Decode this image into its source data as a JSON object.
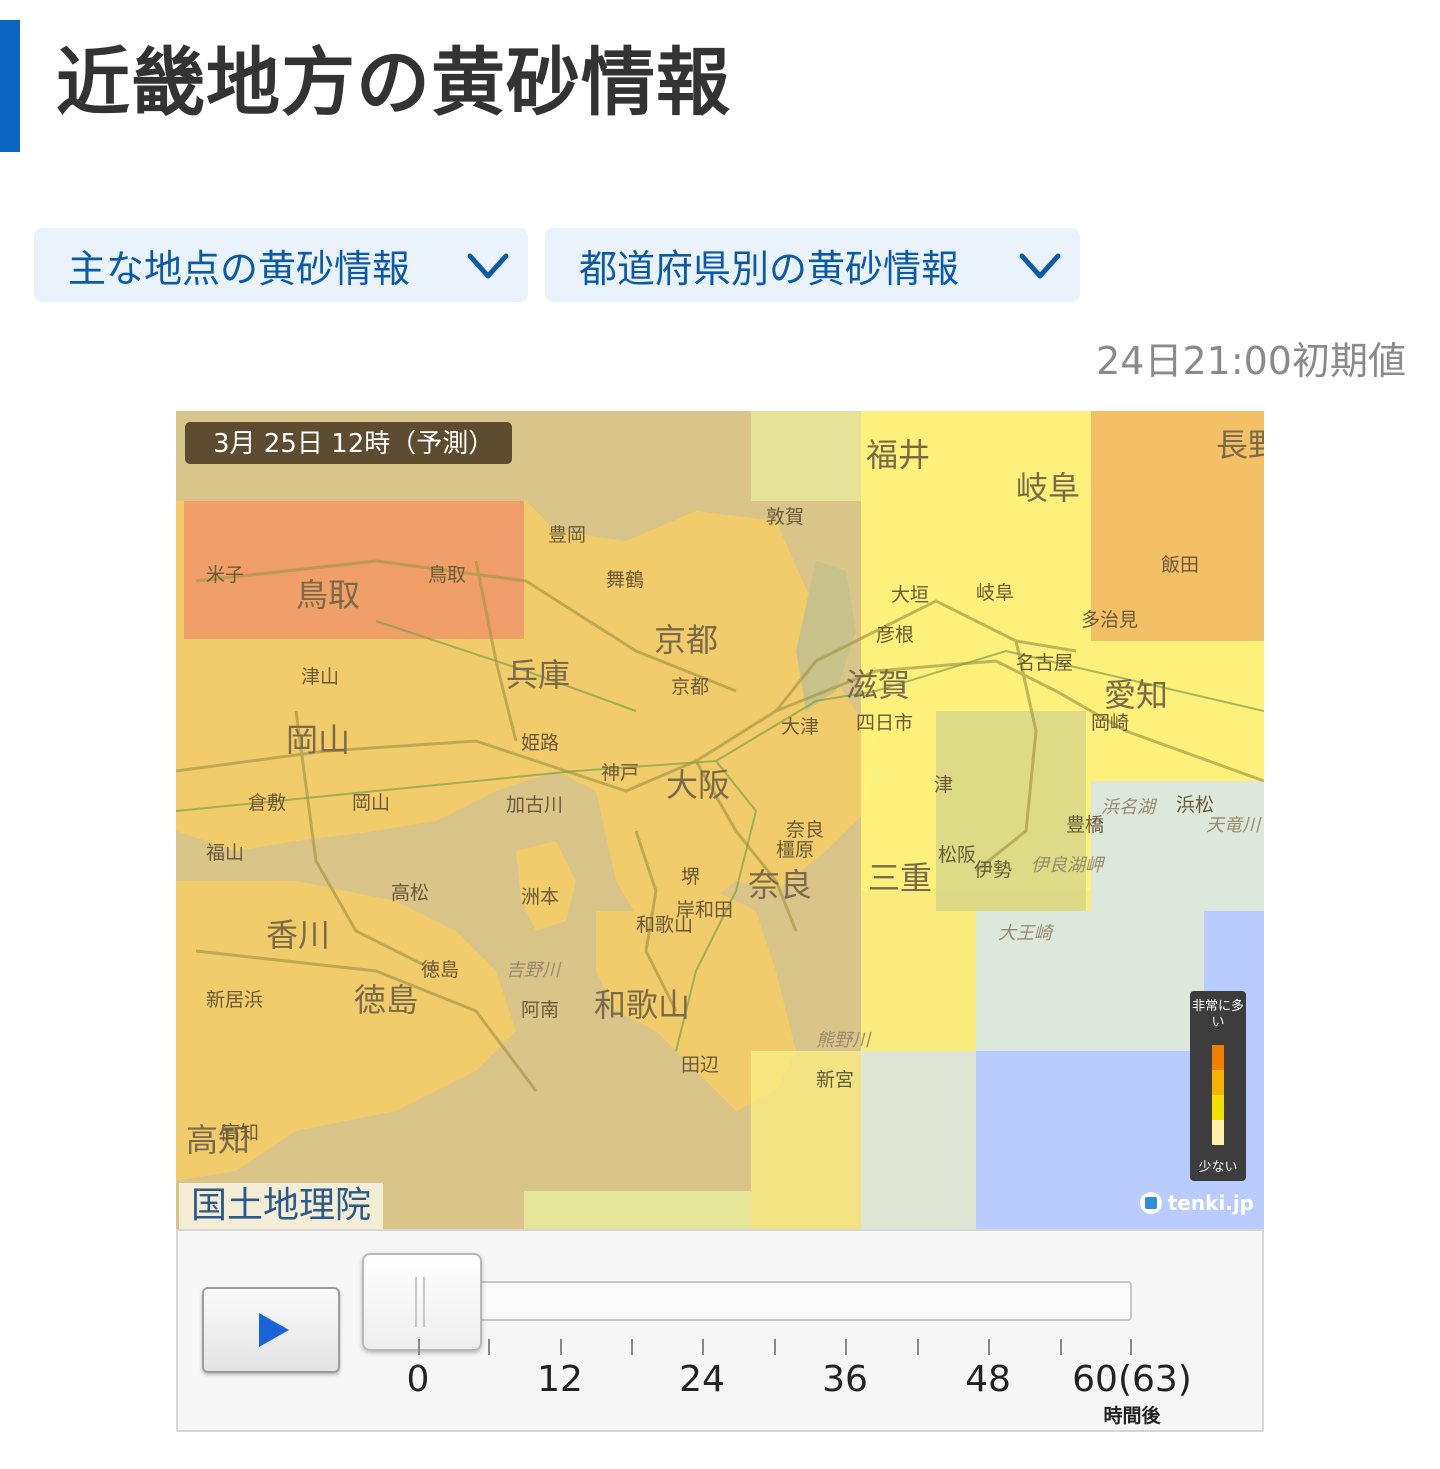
{
  "page": {
    "title": "近畿地方の黄砂情報"
  },
  "dropdowns": [
    {
      "label": "主な地点の黄砂情報",
      "icon": "chevron-down-icon"
    },
    {
      "label": "都道府県別の黄砂情報",
      "icon": "chevron-down-icon"
    }
  ],
  "initial_time": "24日21:00初期値",
  "map": {
    "time_label": "3月 25日 12時（予測）",
    "attribution": "国土地理院",
    "brand": "tenki.jp",
    "prefectures": [
      "福井",
      "岐阜",
      "長野",
      "鳥取",
      "京都",
      "兵庫",
      "滋賀",
      "愛知",
      "岡山",
      "大阪",
      "三重",
      "奈良",
      "香川",
      "徳島",
      "和歌山",
      "高知"
    ],
    "cities": [
      "豊岡",
      "敦賀",
      "米子",
      "鳥取",
      "舞鶴",
      "大垣",
      "岐阜",
      "彦根",
      "飯田",
      "多治見",
      "名古屋",
      "津山",
      "京都",
      "大津",
      "四日市",
      "岡崎",
      "姫路",
      "神戸",
      "奈良",
      "倉敷",
      "岡山",
      "加古川",
      "津",
      "松阪",
      "豊橋",
      "浜松",
      "福山",
      "堺",
      "橿原",
      "伊勢",
      "高松",
      "岸和田",
      "洲本",
      "和歌山",
      "徳島",
      "新居浜",
      "阿南",
      "田辺",
      "新宮",
      "高知"
    ],
    "geo_labels": [
      "吉野川",
      "熊野川",
      "天竜川",
      "浜名湖",
      "伊良湖岬",
      "大王崎"
    ],
    "legend": {
      "high": "非常に多い",
      "low": "少ない",
      "colors": [
        "#f08000",
        "#f6b400",
        "#f4e000",
        "#fff2a8"
      ]
    }
  },
  "timeline": {
    "play_icon": "play-icon",
    "ticks": [
      "0",
      "12",
      "24",
      "36",
      "48",
      "60(63)"
    ],
    "unit": "時間後",
    "current_position": "0"
  }
}
